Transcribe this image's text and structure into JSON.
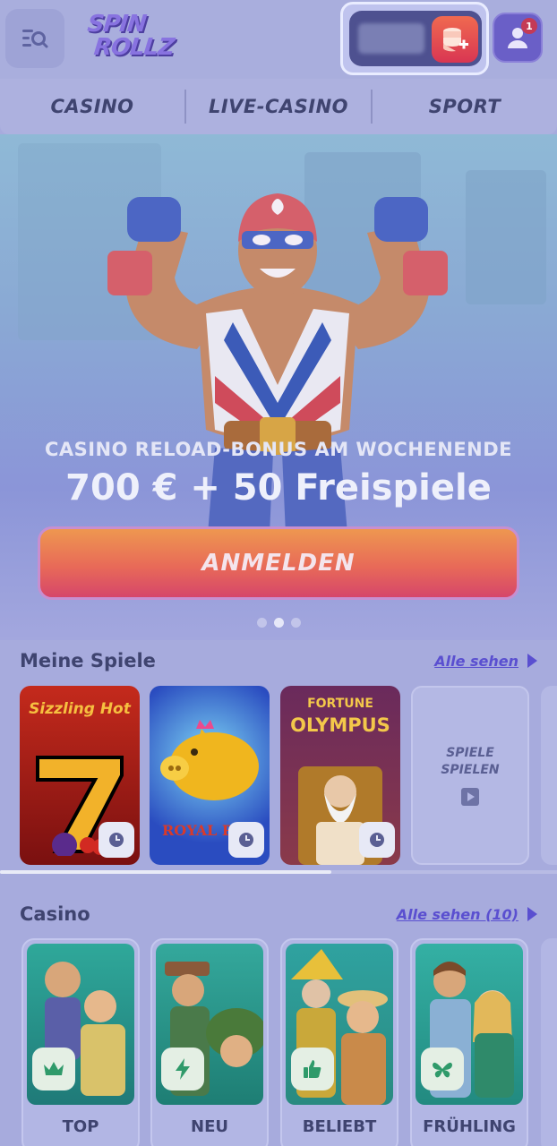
{
  "header": {
    "logo_line1": "SPIN",
    "logo_line2": "ROLLZ",
    "notification_count": "1"
  },
  "nav": {
    "tabs": [
      {
        "label": "CASINO"
      },
      {
        "label": "LIVE-CASINO"
      },
      {
        "label": "SPORT"
      }
    ]
  },
  "hero": {
    "subtitle": "CASINO RELOAD-BONUS AM WOCHENENDE",
    "title": "700 € + 50 Freispiele",
    "cta_label": "ANMELDEN",
    "slides_count": 3,
    "active_slide": 2
  },
  "my_games": {
    "title": "Meine Spiele",
    "see_all": "Alle sehen",
    "games": [
      {
        "name": "Sizzling Hot",
        "art_text": "Sizzling Hot"
      },
      {
        "name": "Royal Pig",
        "art_text": "ROYAL PIG"
      },
      {
        "name": "Fortune of Olympus",
        "art_text_1": "FORTUNE",
        "art_text_2": "OLYMPUS"
      }
    ],
    "play_card_line1": "SPIELE",
    "play_card_line2": "SPIELEN"
  },
  "casino": {
    "title": "Casino",
    "see_all": "Alle sehen (10)",
    "categories": [
      {
        "label": "TOP",
        "icon": "crown-icon"
      },
      {
        "label": "NEU",
        "icon": "lightning-icon"
      },
      {
        "label": "BELIEBT",
        "icon": "thumbs-up-icon"
      },
      {
        "label": "FRÜHLING",
        "icon": "butterfly-icon"
      }
    ]
  },
  "colors": {
    "background": "#a7abdd",
    "accent": "#5a4fd0",
    "cta_start": "#ee9750",
    "cta_end": "#d6466a",
    "deposit": "#e34a52"
  }
}
